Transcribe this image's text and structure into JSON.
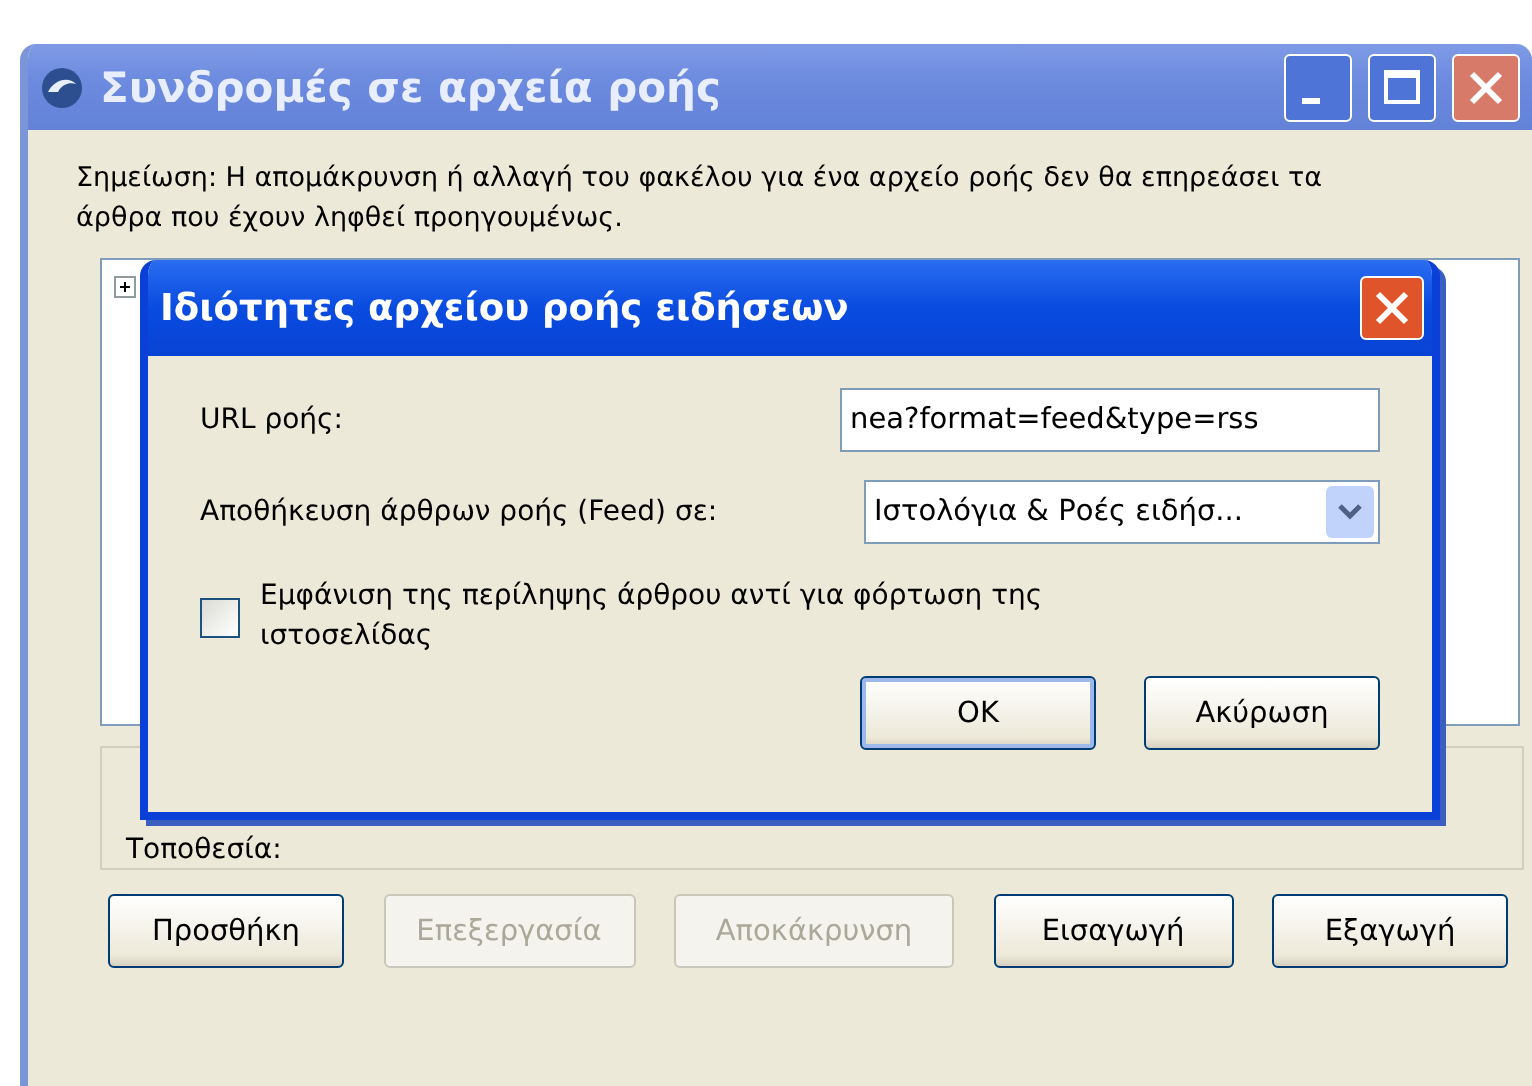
{
  "window": {
    "title": "Συνδρομές σε αρχεία ροής"
  },
  "note": "Σημείωση: Η απομάκρυνση ή αλλαγή του φακέλου για ένα αρχείο ροής δεν θα επηρεάσει τα άρθρα που έχουν ληφθεί προηγουμένως.",
  "tree": {
    "items": [
      {
        "expanded": false
      }
    ]
  },
  "location_label": "Τοποθεσία:",
  "buttons": [
    {
      "label": "Προσθήκη",
      "disabled": false
    },
    {
      "label": "Επεξεργασία",
      "disabled": true
    },
    {
      "label": "Αποκάκρυνση",
      "disabled": true
    },
    {
      "label": "Εισαγωγή",
      "disabled": false
    },
    {
      "label": "Εξαγωγή",
      "disabled": false
    }
  ],
  "dialog": {
    "title": "Ιδιότητες αρχείου ροής ειδήσεων",
    "url_label": "URL ροής:",
    "url_value": "nea?format=feed&type=rss",
    "folder_label": "Αποθήκευση άρθρων ροής (Feed) σε:",
    "folder_value": "Ιστολόγια & Ροές ειδήσ...",
    "checkbox": {
      "label": "Εμφάνιση της περίληψης άρθρου αντί για φόρτωση της ιστοσελίδας",
      "checked": false
    },
    "buttons": [
      {
        "label": "OK",
        "default": true
      },
      {
        "label": "Ακύρωση",
        "default": false
      }
    ]
  }
}
